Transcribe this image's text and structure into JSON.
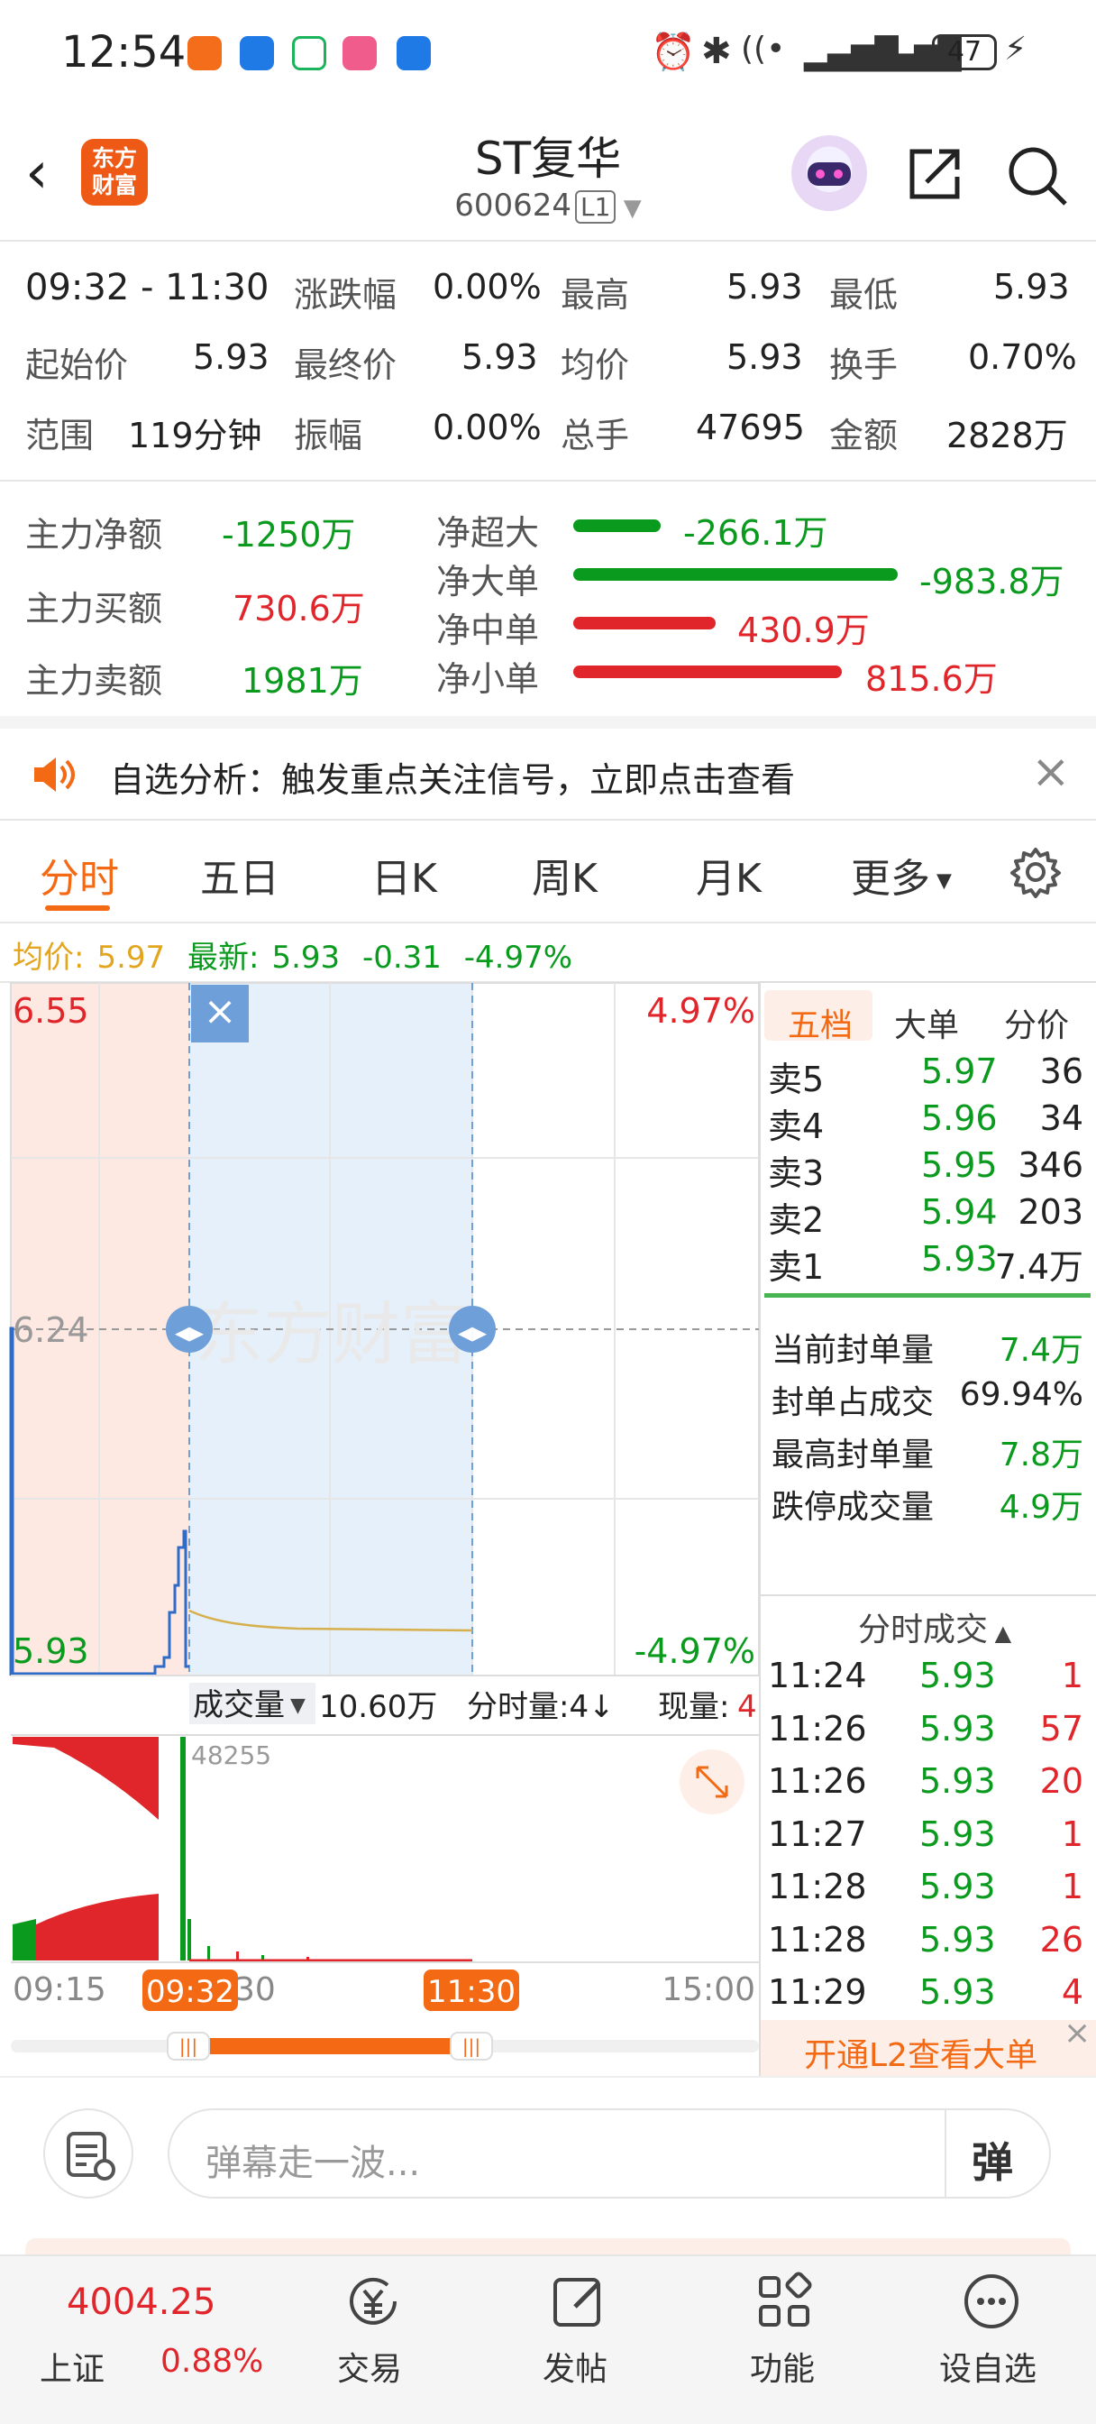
{
  "status": {
    "time": "12:54",
    "battery": "47"
  },
  "header": {
    "title": "ST复华",
    "code": "600624",
    "level": "L1",
    "logo_line1": "东方",
    "logo_line2": "财富"
  },
  "stats": {
    "period": "09:32 - 11:30",
    "row1": [
      {
        "label": "涨跌幅",
        "value": "0.00%"
      },
      {
        "label": "最高",
        "value": "5.93"
      },
      {
        "label": "最低",
        "value": "5.93"
      }
    ],
    "row2": [
      {
        "label": "起始价",
        "value": "5.93"
      },
      {
        "label": "最终价",
        "value": "5.93"
      },
      {
        "label": "均价",
        "value": "5.93"
      },
      {
        "label": "换手",
        "value": "0.70%"
      }
    ],
    "row3": [
      {
        "label": "范围",
        "value": "119分钟"
      },
      {
        "label": "振幅",
        "value": "0.00%"
      },
      {
        "label": "总手",
        "value": "47695"
      },
      {
        "label": "金额",
        "value": "2828万"
      }
    ]
  },
  "flows": {
    "left": [
      {
        "label": "主力净额",
        "value": "-1250万",
        "color": "#0a9a1e"
      },
      {
        "label": "主力买额",
        "value": "730.6万",
        "color": "#e0262b"
      },
      {
        "label": "主力卖额",
        "value": "1981万",
        "color": "#0a9a1e"
      }
    ],
    "right": [
      {
        "label": "净超大",
        "value": "-266.1万",
        "amount": -266.1,
        "color": "#0a9a1e"
      },
      {
        "label": "净大单",
        "value": "-983.8万",
        "amount": -983.8,
        "color": "#0a9a1e"
      },
      {
        "label": "净中单",
        "value": "430.9万",
        "amount": 430.9,
        "color": "#e0262b"
      },
      {
        "label": "净小单",
        "value": "815.6万",
        "amount": 815.6,
        "color": "#e0262b"
      }
    ]
  },
  "notice": {
    "text": "自选分析：触发重点关注信号，立即点击查看"
  },
  "tabs": [
    "分时",
    "五日",
    "日K",
    "周K",
    "月K",
    "更多"
  ],
  "legend": {
    "avg_label": "均价:",
    "avg_value": "5.97",
    "last_label": "最新:",
    "last_value": "5.93",
    "change": "-0.31",
    "pct": "-4.97%"
  },
  "chart": {
    "y_top": "6.55",
    "y_mid": "6.24",
    "y_bot": "5.93",
    "pct_top": "4.97%",
    "pct_bot": "-4.97%",
    "watermark": "东方财富",
    "vol_label": "成交量",
    "vol_total": "10.60万",
    "vol_max": "48255",
    "fsl_label": "分时量:4↓",
    "xl_label": "现量:",
    "xl_value": "4",
    "t_start": "09:15",
    "t_sel_start": "09:32",
    "t_mid_tail": "30",
    "t_sel_end": "11:30",
    "t_end": "15:00"
  },
  "orderbook": {
    "tabs": [
      "五档",
      "大单",
      "分价"
    ],
    "asks": [
      {
        "label": "卖5",
        "price": "5.97",
        "vol": "36"
      },
      {
        "label": "卖4",
        "price": "5.96",
        "vol": "34"
      },
      {
        "label": "卖3",
        "price": "5.95",
        "vol": "346"
      },
      {
        "label": "卖2",
        "price": "5.94",
        "vol": "203"
      },
      {
        "label": "卖1",
        "price": "5.93",
        "vol": "7.4万"
      }
    ],
    "seal": [
      {
        "label": "当前封单量",
        "value": "7.4万"
      },
      {
        "label": "封单占成交",
        "value": "69.94%"
      },
      {
        "label": "最高封单量",
        "value": "7.8万"
      },
      {
        "label": "跌停成交量",
        "value": "4.9万"
      }
    ]
  },
  "trades": {
    "title": "分时成交",
    "rows": [
      {
        "t": "11:24",
        "p": "5.93",
        "v": "1"
      },
      {
        "t": "11:26",
        "p": "5.93",
        "v": "57"
      },
      {
        "t": "11:26",
        "p": "5.93",
        "v": "20"
      },
      {
        "t": "11:27",
        "p": "5.93",
        "v": "1"
      },
      {
        "t": "11:28",
        "p": "5.93",
        "v": "1"
      },
      {
        "t": "11:28",
        "p": "5.93",
        "v": "26"
      },
      {
        "t": "11:29",
        "p": "5.93",
        "v": "4"
      }
    ],
    "l2": "开通L2查看大单"
  },
  "comment": {
    "placeholder": "弹幕走一波...",
    "send": "弹"
  },
  "bottom": {
    "index_value": "4004.25",
    "index_name": "上证",
    "index_pct": "0.88%",
    "items": [
      "交易",
      "发帖",
      "功能",
      "设自选"
    ]
  }
}
